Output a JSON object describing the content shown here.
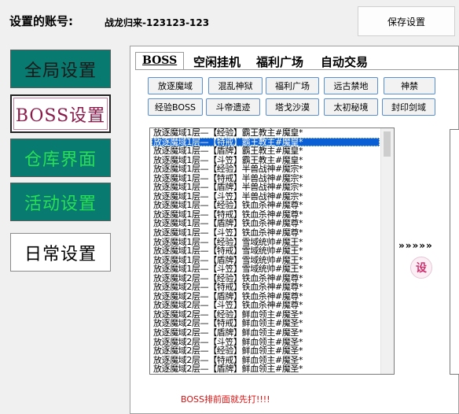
{
  "account": {
    "label": "设置的账号:",
    "value": "战龙归来-123123-123"
  },
  "save_button": "保存设置",
  "nav": [
    {
      "label": "全局设置"
    },
    {
      "label": "BOSS设置"
    },
    {
      "label": "仓库界面"
    },
    {
      "label": "活动设置"
    },
    {
      "label": "日常设置"
    }
  ],
  "tabs": [
    {
      "label": "BOSS"
    },
    {
      "label": "空闲挂机"
    },
    {
      "label": "福利广场"
    },
    {
      "label": "自动交易"
    }
  ],
  "categories": [
    {
      "label": "放逐魔域"
    },
    {
      "label": "混乱神狱"
    },
    {
      "label": "福利广场"
    },
    {
      "label": "远古禁地"
    },
    {
      "label": "神禁"
    },
    {
      "label": "经验BOSS"
    },
    {
      "label": "斗帝遗迹"
    },
    {
      "label": "塔戈沙漠"
    },
    {
      "label": "太初秘境"
    },
    {
      "label": "封印剑域"
    }
  ],
  "boss_list": [
    "放逐魔域1层—【经验】霸王教主#魔皇*",
    "放逐魔域1层—【特戒】霸王教主#魔皇*",
    "放逐魔域1层—【盾牌】霸王教主#魔皇*",
    "放逐魔域1层—【斗笠】霸王教主#魔皇*",
    "放逐魔域1层—【经验】半兽战神#魔宗*",
    "放逐魔域1层—【特戒】半兽战神#魔宗*",
    "放逐魔域1层—【盾牌】半兽战神#魔宗*",
    "放逐魔域1层—【斗笠】半兽战神#魔宗*",
    "放逐魔域1层—【经验】铁血杀神#魔尊*",
    "放逐魔域1层—【特戒】铁血杀神#魔尊*",
    "放逐魔域1层—【盾牌】铁血杀神#魔尊*",
    "放逐魔域1层—【斗笠】铁血杀神#魔尊*",
    "放逐魔域1层—【经验】雪域统帅#魔王*",
    "放逐魔域1层—【特戒】雪域统帅#魔王*",
    "放逐魔域1层—【盾牌】雪域统帅#魔王*",
    "放逐魔域1层—【斗笠】雪域统帅#魔王*",
    "放逐魔域2层—【经验】铁血杀神#魔尊*",
    "放逐魔域2层—【特戒】铁血杀神#魔尊*",
    "放逐魔域2层—【盾牌】铁血杀神#魔尊*",
    "放逐魔域2层—【斗笠】铁血杀神#魔尊*",
    "放逐魔域2层—【经验】鲜血领主#魔圣*",
    "放逐魔域2层—【特戒】鲜血领主#魔圣*",
    "放逐魔域2层—【盾牌】鲜血领主#魔圣*",
    "放逐魔域2层—【斗笠】鲜血领主#魔圣*",
    "放逐魔域2层—【经验】鲜血领主#魔圣*",
    "放逐魔域2层—【特戒】鲜血领主#魔圣*",
    "放逐魔域2层—【盾牌】鲜血领主#魔圣*"
  ],
  "selected_index": 1,
  "arrows": "»»»»»",
  "set_icon": "设",
  "notice": "BOSS排前面就先打!!!!",
  "colors": {
    "nav_teal": "#087a70",
    "nav_green_text": "#27e055",
    "selection": "#0a5fd4",
    "notice": "#d91010"
  }
}
